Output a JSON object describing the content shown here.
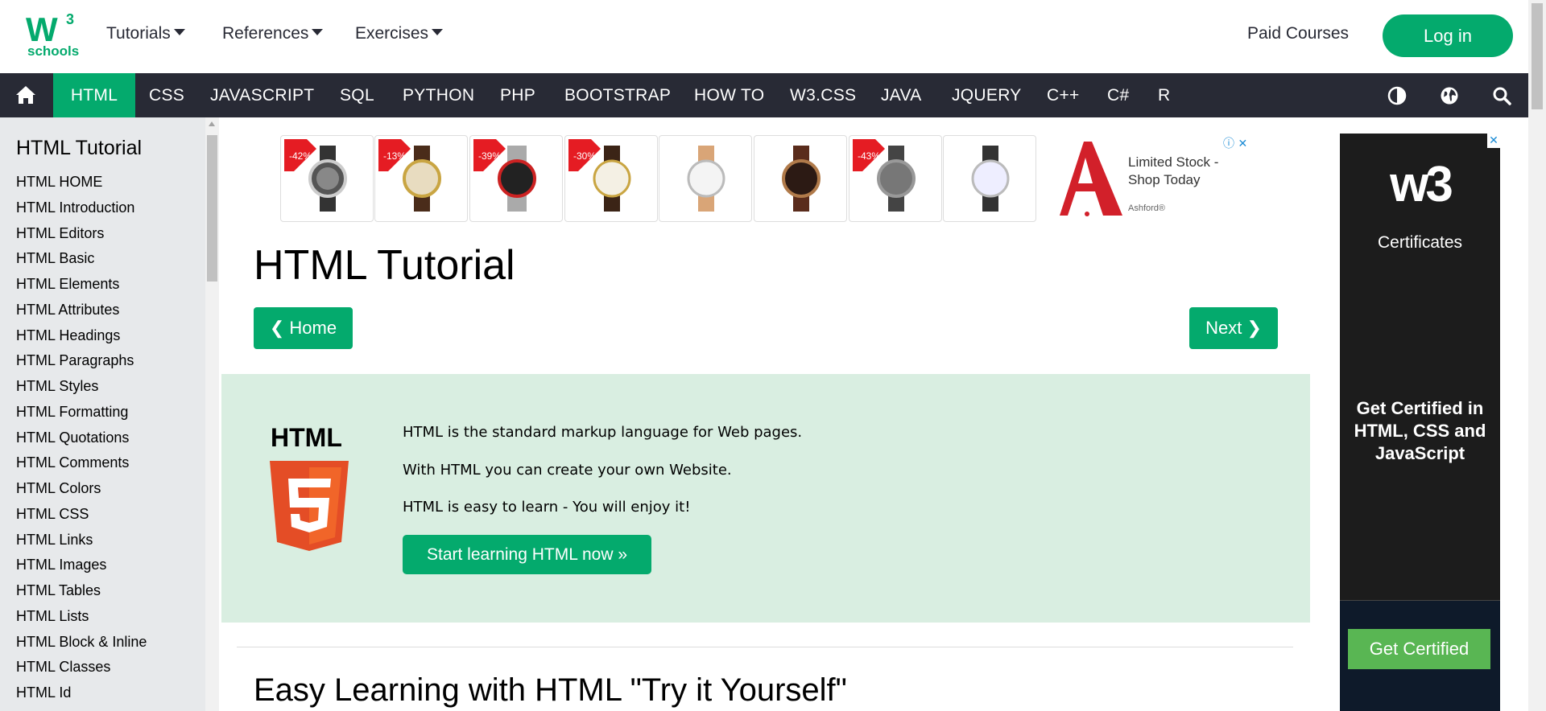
{
  "logo": {
    "main": "W",
    "superscript": "3",
    "sub": "schools"
  },
  "top_nav": {
    "items": [
      {
        "label": "Tutorials"
      },
      {
        "label": "References"
      },
      {
        "label": "Exercises"
      }
    ],
    "paid_courses": "Paid Courses",
    "login": "Log in"
  },
  "main_nav": {
    "items": [
      {
        "label": "HTML",
        "active": true
      },
      {
        "label": "CSS"
      },
      {
        "label": "JAVASCRIPT"
      },
      {
        "label": "SQL"
      },
      {
        "label": "PYTHON"
      },
      {
        "label": "PHP"
      },
      {
        "label": "BOOTSTRAP"
      },
      {
        "label": "HOW TO"
      },
      {
        "label": "W3.CSS"
      },
      {
        "label": "JAVA"
      },
      {
        "label": "JQUERY"
      },
      {
        "label": "C++"
      },
      {
        "label": "C#"
      },
      {
        "label": "R"
      }
    ],
    "icons": [
      "home-icon",
      "contrast-icon",
      "globe-icon",
      "search-icon"
    ]
  },
  "sidebar": {
    "title": "HTML Tutorial",
    "items": [
      "HTML HOME",
      "HTML Introduction",
      "HTML Editors",
      "HTML Basic",
      "HTML Elements",
      "HTML Attributes",
      "HTML Headings",
      "HTML Paragraphs",
      "HTML Styles",
      "HTML Formatting",
      "HTML Quotations",
      "HTML Comments",
      "HTML Colors",
      "HTML CSS",
      "HTML Links",
      "HTML Images",
      "HTML Tables",
      "HTML Lists",
      "HTML Block & Inline",
      "HTML Classes",
      "HTML Id"
    ]
  },
  "ad_banner": {
    "discounts": [
      "-42%",
      "-13%",
      "-39%",
      "-30%",
      "",
      "",
      "-43%",
      ""
    ],
    "text": "Limited Stock - Shop Today",
    "brand": "Ashford®"
  },
  "main": {
    "title": "HTML Tutorial",
    "home_button": "❮ Home",
    "next_button": "Next ❯",
    "intro": {
      "badge": "HTML",
      "lines": [
        "HTML is the standard markup language for Web pages.",
        "With HTML you can create your own Website.",
        "HTML is easy to learn - You will enjoy it!"
      ],
      "start_button": "Start learning HTML now »"
    },
    "section_title": "Easy Learning with HTML \"Try it Yourself\""
  },
  "right_ad": {
    "logo": "w3",
    "certificates": "Certificates",
    "headline": "Get Certified in HTML, CSS and JavaScript",
    "button": "Get Certified"
  },
  "colors": {
    "brand_green": "#04AA6D",
    "nav_dark": "#282A35",
    "sidebar_bg": "#E7E9EB",
    "intro_bg": "#D9EEE1",
    "html5_orange": "#F06529"
  }
}
